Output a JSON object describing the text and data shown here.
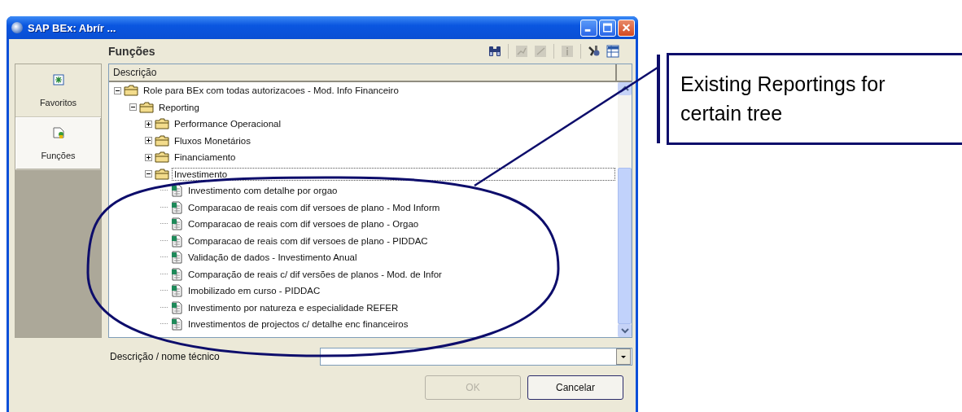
{
  "window": {
    "title": "SAP BEx: Abrír ..."
  },
  "sidebar": {
    "items": [
      {
        "label": "Favoritos",
        "selected": false
      },
      {
        "label": "Funções",
        "selected": true
      }
    ]
  },
  "panel": {
    "title": "Funções"
  },
  "toolbar": [
    {
      "disabled": false
    },
    {
      "disabled": true
    },
    {
      "disabled": true
    },
    {
      "disabled": true
    },
    {
      "disabled": false
    },
    {
      "disabled": false
    }
  ],
  "tree": {
    "column": "Descrição",
    "items": [
      {
        "kind": "folder",
        "label": "Role para BEx com todas autorizacoes - Mod. Info Financeiro",
        "expanded": true,
        "selected": false,
        "children": [
          {
            "kind": "folder",
            "label": "Reporting",
            "expanded": true,
            "selected": false,
            "children": [
              {
                "kind": "folder",
                "label": "Performance Operacional",
                "expanded": false,
                "selected": false
              },
              {
                "kind": "folder",
                "label": "Fluxos Monetários",
                "expanded": false,
                "selected": false
              },
              {
                "kind": "folder",
                "label": "Financiamento",
                "expanded": false,
                "selected": false
              },
              {
                "kind": "folder",
                "label": "Investimento",
                "expanded": true,
                "selected": true,
                "children": [
                  {
                    "kind": "report",
                    "label": "Investimento com detalhe por orgao",
                    "selected": false
                  },
                  {
                    "kind": "report",
                    "label": "Comparacao de reais com dif versoes de plano - Mod Inform",
                    "selected": false
                  },
                  {
                    "kind": "report",
                    "label": "Comparacao de reais com dif versoes de plano - Orgao",
                    "selected": false
                  },
                  {
                    "kind": "report",
                    "label": "Comparacao de reais com dif versoes de plano - PIDDAC",
                    "selected": false
                  },
                  {
                    "kind": "report",
                    "label": "Validação de dados - Investimento Anual",
                    "selected": false
                  },
                  {
                    "kind": "report",
                    "label": "Comparação de reais c/ dif versões de planos - Mod. de Infor",
                    "selected": false
                  },
                  {
                    "kind": "report",
                    "label": "Imobilizado em curso - PIDDAC",
                    "selected": false
                  },
                  {
                    "kind": "report",
                    "label": "Investimento por natureza e especialidade REFER",
                    "selected": false
                  },
                  {
                    "kind": "report",
                    "label": "Investimentos de projectos c/ detalhe enc financeiros",
                    "selected": false
                  }
                ]
              }
            ]
          }
        ]
      }
    ]
  },
  "search": {
    "label": "Descrição / nome técnico"
  },
  "buttons": [
    {
      "label": "OK",
      "disabled": true
    },
    {
      "label": "Cancelar",
      "disabled": false
    }
  ],
  "annotation": {
    "text": "Existing Reportings for certain tree"
  }
}
